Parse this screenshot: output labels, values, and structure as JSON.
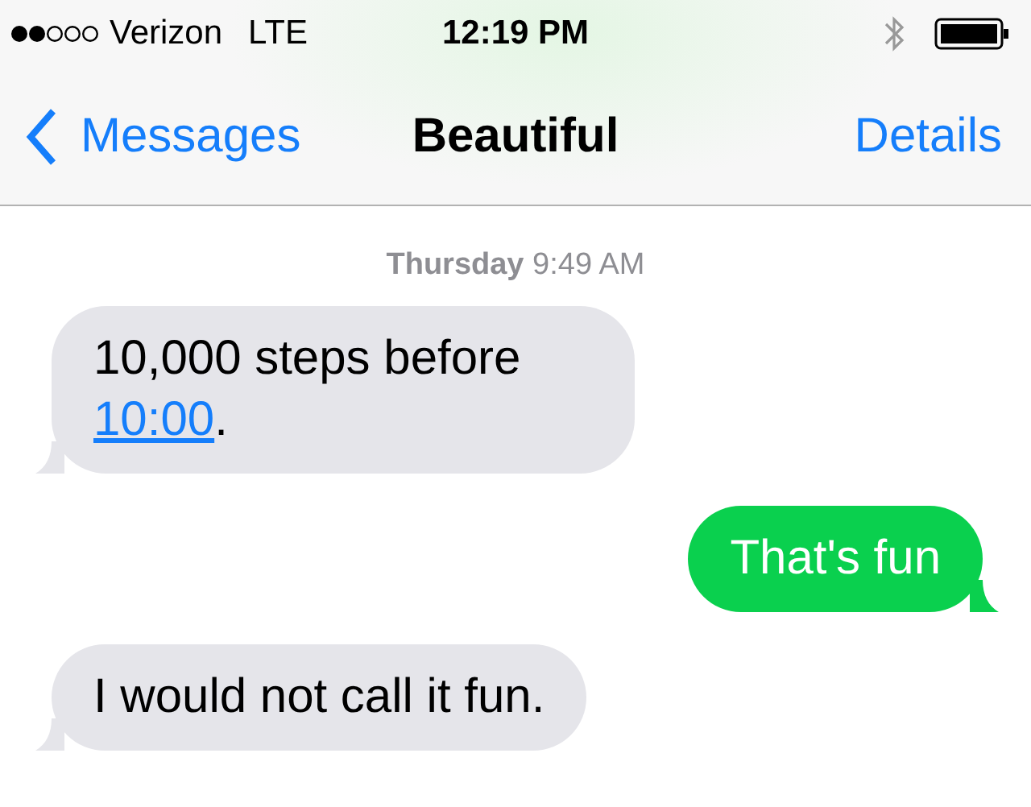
{
  "status_bar": {
    "carrier": "Verizon",
    "network": "LTE",
    "time": "12:19 PM"
  },
  "nav": {
    "back": "Messages",
    "title": "Beautiful",
    "action": "Details"
  },
  "timestamp": {
    "day": "Thursday",
    "time": "9:49 AM"
  },
  "messages": [
    {
      "kind": "received",
      "parts": [
        {
          "kind": "text",
          "text": "10,000 steps before "
        },
        {
          "kind": "link",
          "text": "10:00"
        },
        {
          "kind": "text",
          "text": "."
        }
      ]
    },
    {
      "kind": "sent",
      "parts": [
        {
          "kind": "text",
          "text": "That's fun"
        }
      ]
    },
    {
      "kind": "received",
      "parts": [
        {
          "kind": "text",
          "text": "I would not call it fun."
        }
      ]
    }
  ]
}
